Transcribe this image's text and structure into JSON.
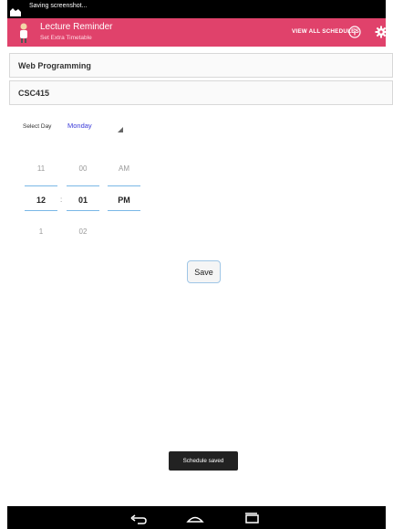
{
  "status_bar": {
    "text": "Saving screenshot...",
    "icon": "screenshot-icon"
  },
  "app_bar": {
    "title": "Lecture Reminder",
    "subtitle": "Set Extra Timetable",
    "view_all_label": "VIEW ALL SCHEDULES",
    "info_icon": "info-icon",
    "settings_icon": "gear-icon",
    "color": "#e0426b"
  },
  "form": {
    "course_name": "Web Programming",
    "course_code": "CSC415",
    "day_label": "Select Day",
    "day_value": "Monday"
  },
  "time_picker": {
    "hour": {
      "prev": "11",
      "current": "12",
      "next": "1"
    },
    "minute": {
      "prev": "00",
      "current": "01",
      "next": "02"
    },
    "ampm": {
      "prev": "AM",
      "current": "PM"
    },
    "separator": ":"
  },
  "save_label": "Save",
  "toast": "Schedule saved",
  "nav": {
    "back_icon": "back-icon",
    "home_icon": "home-icon",
    "recents_icon": "recents-icon"
  }
}
